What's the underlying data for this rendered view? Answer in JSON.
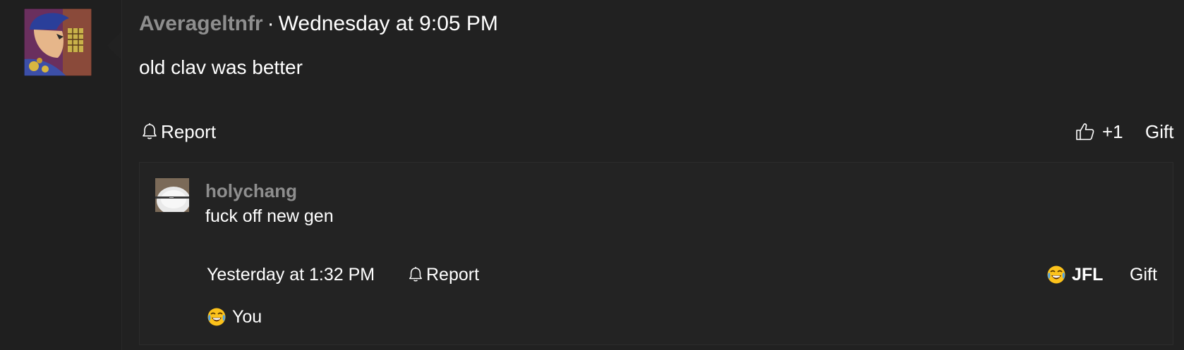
{
  "post": {
    "author": "Averageltnfr",
    "separator": "·",
    "timestamp": "Wednesday at 9:05 PM",
    "body": "old clav was better",
    "actions": {
      "report_label": "Report",
      "like_label": "+1",
      "gift_label": "Gift"
    }
  },
  "reply": {
    "author": "holychang",
    "body": "fuck off new gen",
    "timestamp": "Yesterday at 1:32 PM",
    "actions": {
      "report_label": "Report",
      "reaction_label": "JFL",
      "gift_label": "Gift"
    },
    "reactors_label": "You"
  },
  "icons": {
    "report": "bell-icon",
    "like": "thumbs-up-icon",
    "reaction": "crying-laughing-emoji-icon"
  },
  "colors": {
    "background": "#212121",
    "username": "#8e8e8e",
    "text": "#ffffff"
  }
}
